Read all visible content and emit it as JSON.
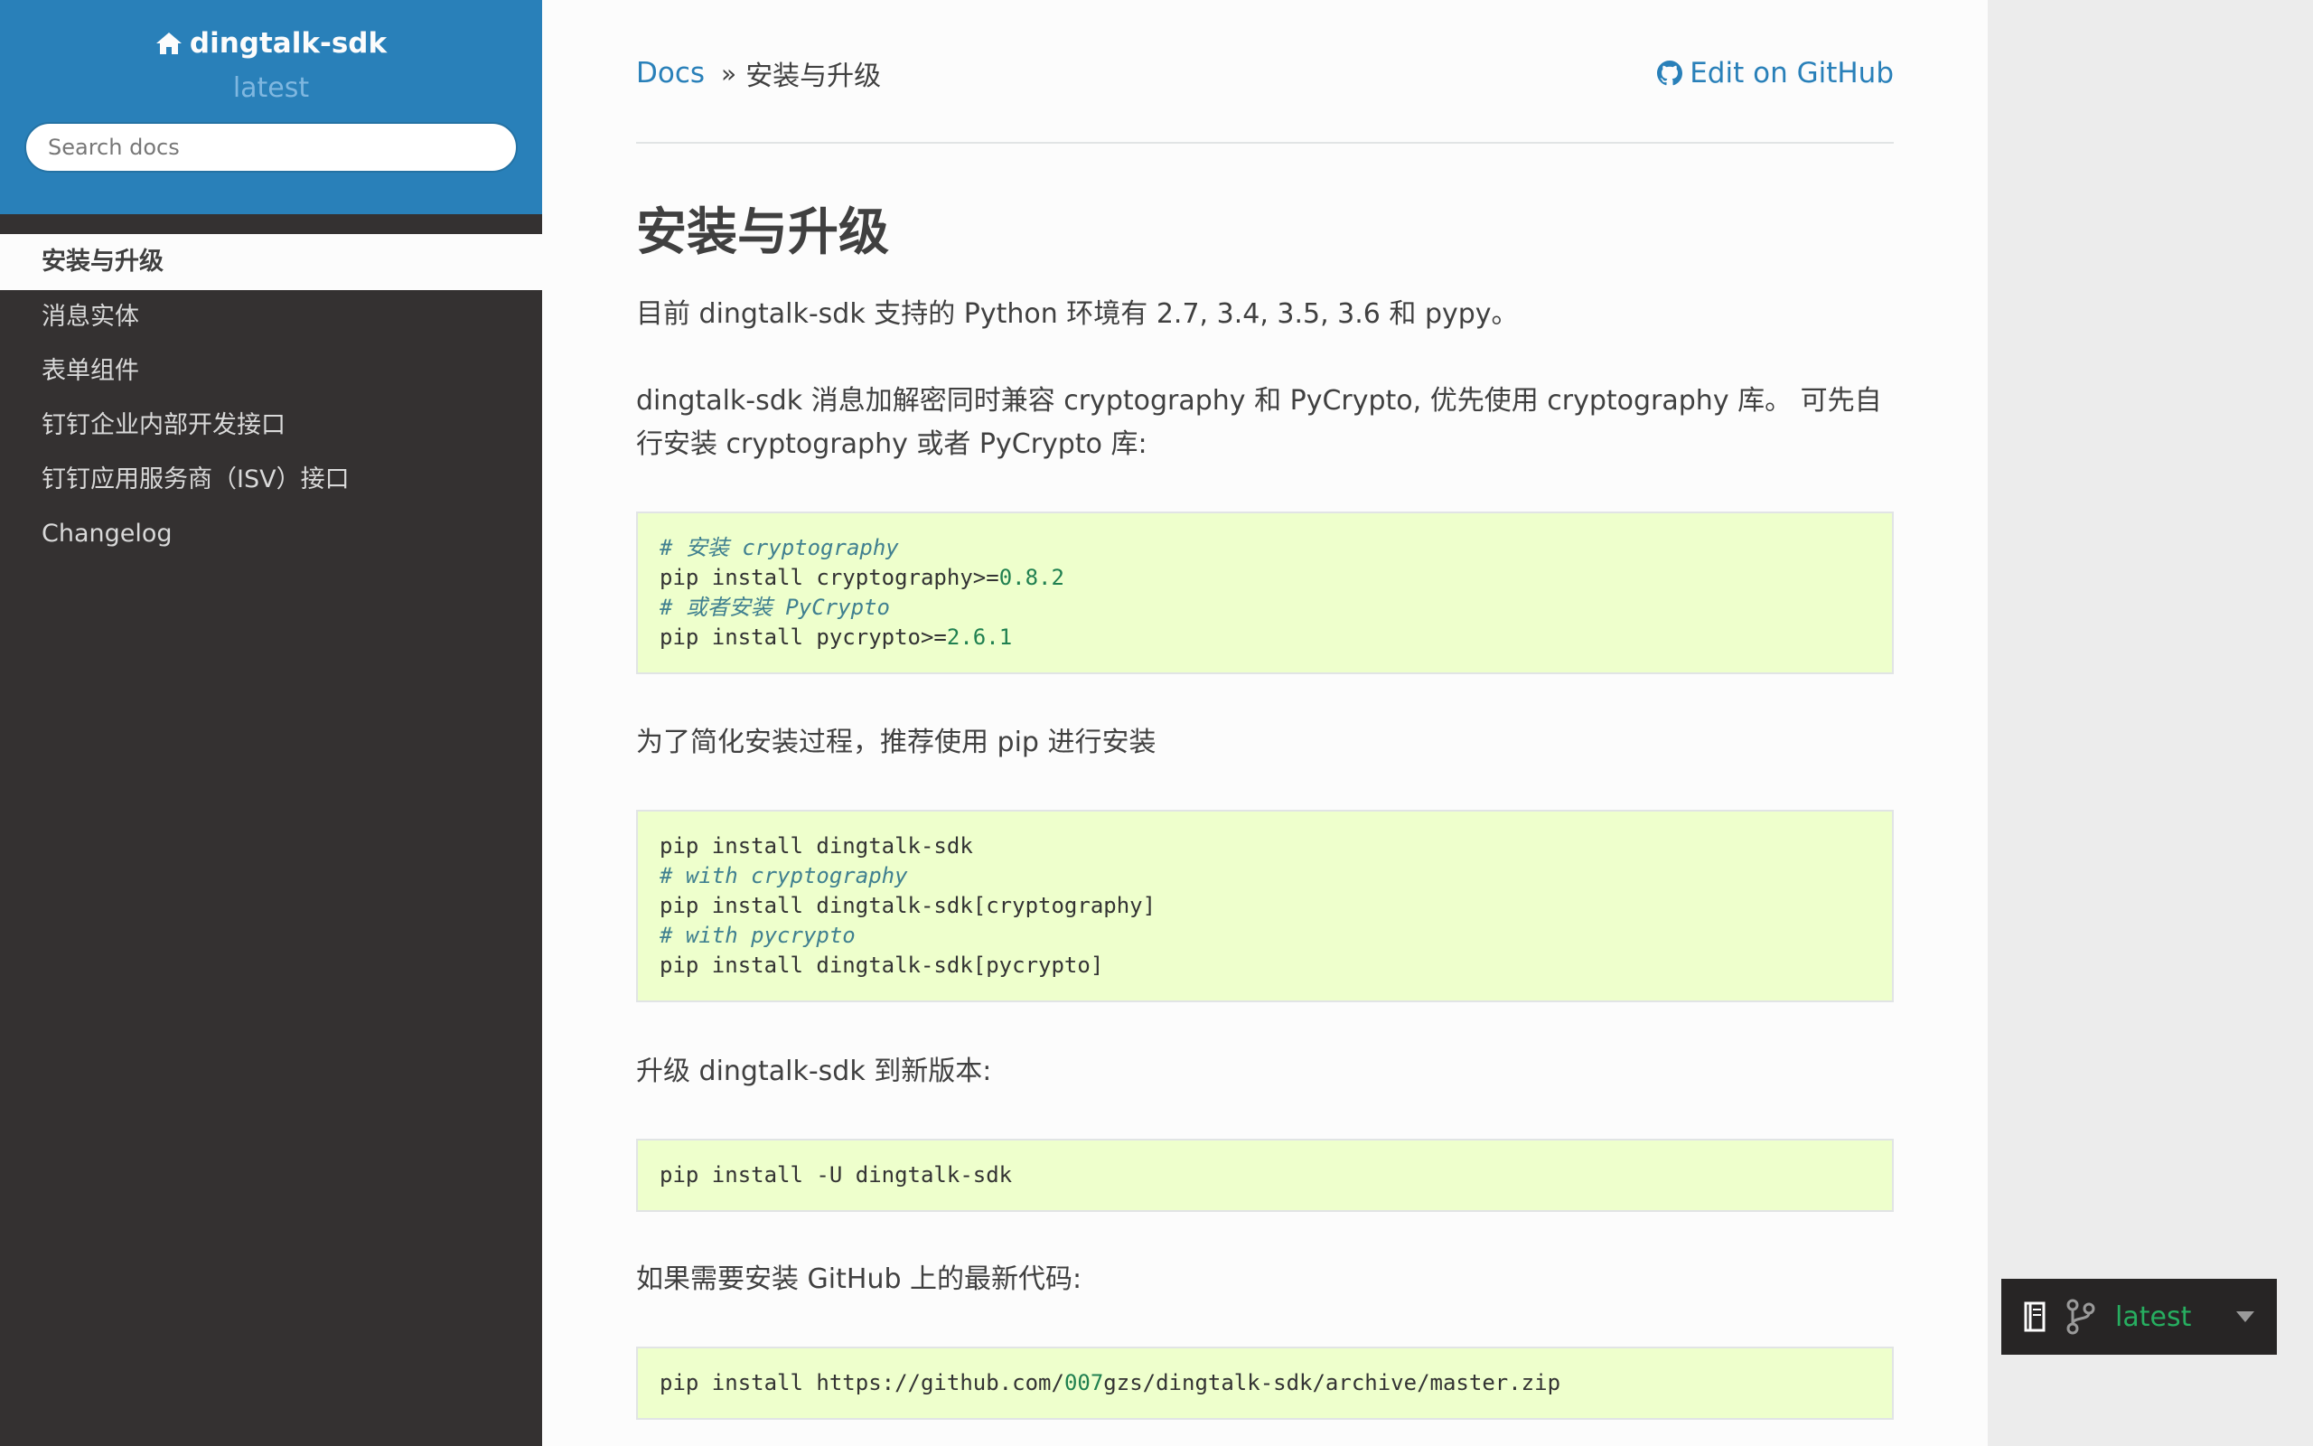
{
  "sidebar": {
    "brand": "dingtalk-sdk",
    "version": "latest",
    "search_placeholder": "Search docs",
    "items": [
      {
        "label": "安装与升级"
      },
      {
        "label": "消息实体"
      },
      {
        "label": "表单组件"
      },
      {
        "label": "钉钉企业内部开发接口"
      },
      {
        "label": "钉钉应用服务商（ISV）接口"
      },
      {
        "label": "Changelog"
      }
    ]
  },
  "breadcrumb": {
    "root": "Docs",
    "separator": "»",
    "current": "安装与升级",
    "edit_label": "Edit on GitHub"
  },
  "main": {
    "title": "安装与升级",
    "p1": "目前 dingtalk-sdk 支持的 Python 环境有 2.7, 3.4, 3.5, 3.6 和 pypy。",
    "p2": "dingtalk-sdk 消息加解密同时兼容 cryptography 和 PyCrypto, 优先使用 cryptography 库。 可先自行安装 cryptography 或者 PyCrypto 库:",
    "code1": {
      "l1_comment": "# 安装 cryptography",
      "l2_cmd": "pip install cryptography",
      "l2_op": ">=",
      "l2_ver": "0.8.2",
      "l3_comment": "# 或者安装 PyCrypto",
      "l4_cmd": "pip install pycrypto",
      "l4_op": ">=",
      "l4_ver": "2.6.1"
    },
    "p3": "为了简化安装过程，推荐使用 pip 进行安装",
    "code2": {
      "l1": "pip install dingtalk-sdk",
      "l2_comment": "# with cryptography",
      "l3": "pip install dingtalk-sdk[cryptography]",
      "l4_comment": "# with pycrypto",
      "l5": "pip install dingtalk-sdk[pycrypto]"
    },
    "p4": "升级 dingtalk-sdk 到新版本:",
    "code3": {
      "l1": "pip install -U dingtalk-sdk"
    },
    "p5": "如果需要安装 GitHub 上的最新代码:",
    "code4": {
      "pre": "pip install https://github.com/",
      "num": "007",
      "post": "gzs/dingtalk-sdk/archive/master.zip"
    }
  },
  "rtd_badge": {
    "version": "latest",
    "accent": "#27ae60"
  },
  "colors": {
    "sidebar_top": "#2980b9",
    "sidebar_bg": "#343131",
    "link": "#2980b9",
    "code_bg": "#eeffcc"
  }
}
